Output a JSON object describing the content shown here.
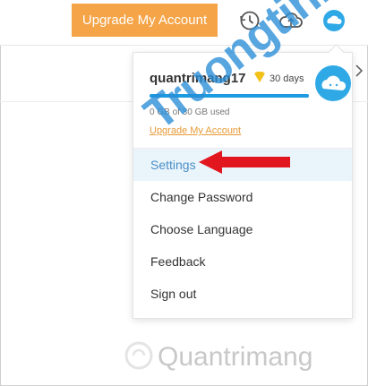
{
  "header": {
    "upgrade_label": "Upgrade My Account",
    "icons": [
      "history-icon",
      "cloud-upload-icon",
      "avatar-icon"
    ]
  },
  "account": {
    "username": "quantrimang17",
    "vip_badge": "vip-icon",
    "days_left": "30 days",
    "storage_used_fraction": 0.0,
    "storage_text": "0 GB of 30 GB used",
    "upgrade_link": "Upgrade My Account"
  },
  "menu": {
    "items": [
      {
        "label": "Settings",
        "active": true
      },
      {
        "label": "Change Password",
        "active": false
      },
      {
        "label": "Choose Language",
        "active": false
      },
      {
        "label": "Feedback",
        "active": false
      },
      {
        "label": "Sign out",
        "active": false
      }
    ]
  },
  "watermarks": {
    "diagonal": "Truongtin.top",
    "bottom": "Quantrimang"
  },
  "colors": {
    "accent_orange": "#f5a447",
    "primary_blue": "#1c9be0",
    "active_bg": "#eaf4fb",
    "arrow_red": "#e2161f"
  }
}
